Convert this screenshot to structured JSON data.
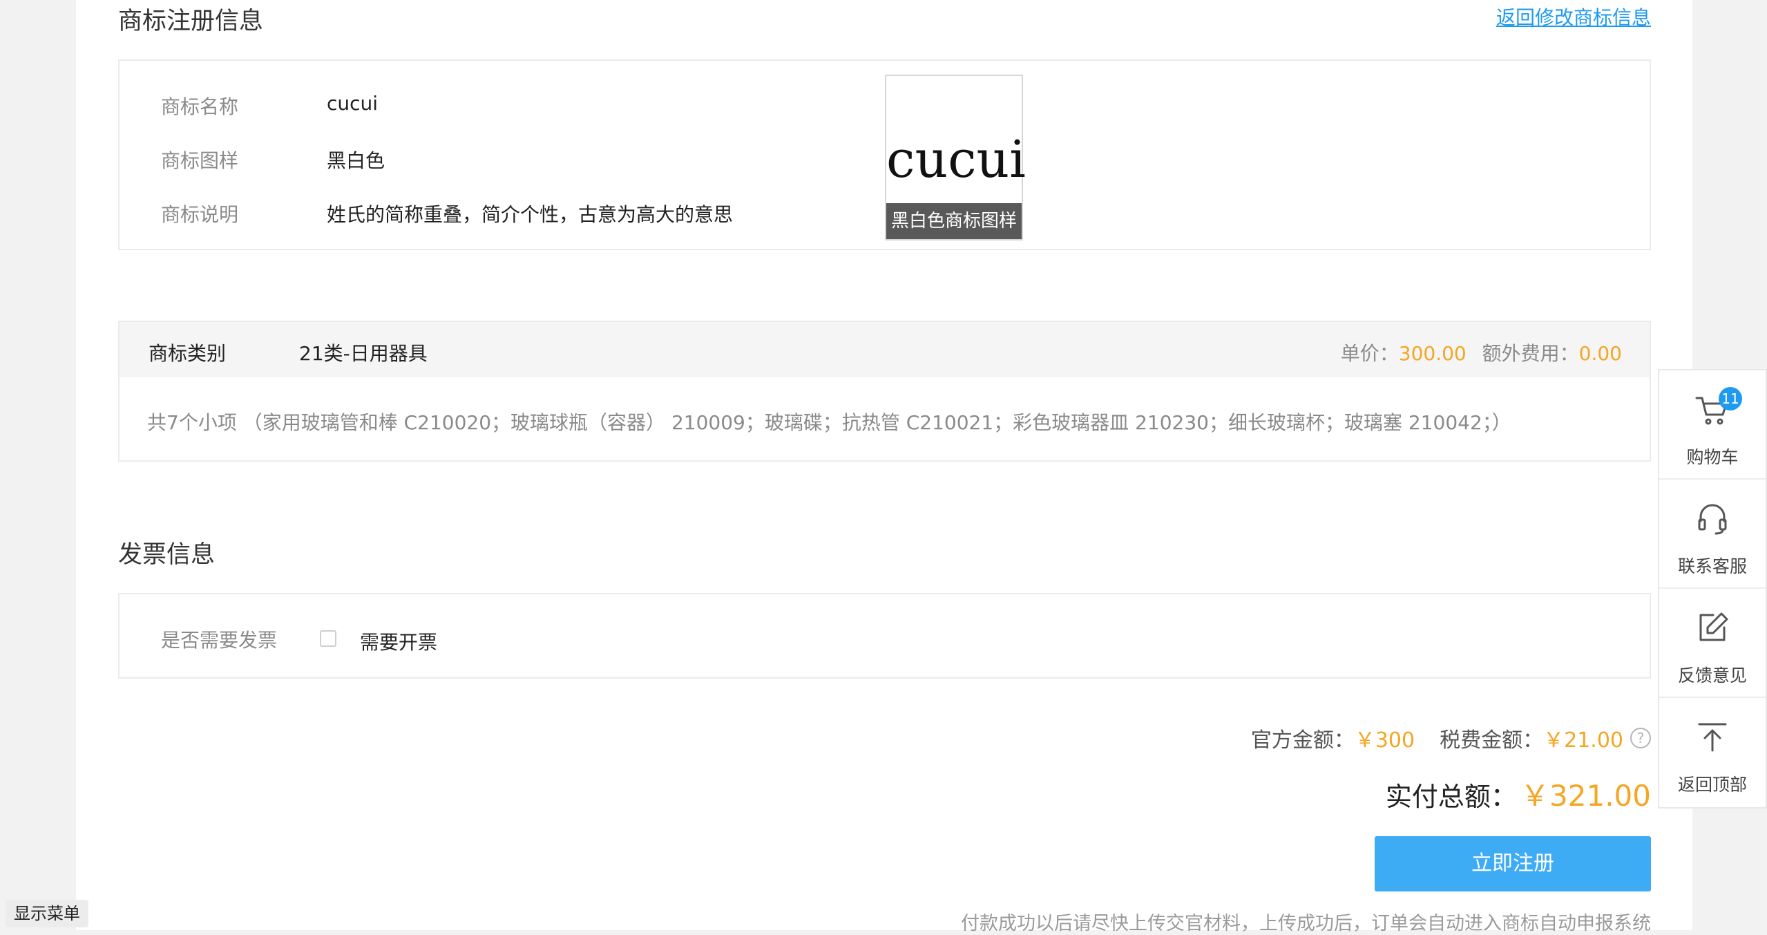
{
  "header": {
    "title": "商标注册信息",
    "back_link": "返回修改商标信息"
  },
  "trademark": {
    "name_label": "商标名称",
    "name_value": "cucui",
    "pattern_label": "商标图样",
    "pattern_value": "黑白色",
    "desc_label": "商标说明",
    "desc_value": "姓氏的简称重叠，简介个性，古意为高大的意思",
    "logo_text": "cucui",
    "logo_caption": "黑白色商标图样"
  },
  "category": {
    "label": "商标类别",
    "value": "21类-日用器具",
    "unit_price_label": "单价：",
    "unit_price": "300.00",
    "extra_fee_label": "额外费用：",
    "extra_fee": "0.00",
    "items_text": "共7个小项 （家用玻璃管和棒 C210020；玻璃球瓶（容器） 210009；玻璃碟；抗热管 C210021；彩色玻璃器皿 210230；细长玻璃杯；玻璃塞 210042；）"
  },
  "invoice": {
    "title": "发票信息",
    "need_label": "是否需要发票",
    "checkbox_label": "需要开票",
    "checked": false
  },
  "summary": {
    "official_label": "官方金额：",
    "official_value": "￥300",
    "tax_label": "税费金额：",
    "tax_value": "￥21.00",
    "tax_help": "?",
    "total_label": "实付总额：",
    "total_value": "￥321.00",
    "submit_label": "立即注册",
    "note": "付款成功以后请尽快上传交官材料，上传成功后，订单会自动进入商标自动申报系统"
  },
  "sidebar": {
    "items": [
      {
        "label": "购物车",
        "icon": "cart-icon",
        "badge": "11"
      },
      {
        "label": "联系客服",
        "icon": "headset-icon"
      },
      {
        "label": "反馈意见",
        "icon": "edit-icon"
      },
      {
        "label": "返回顶部",
        "icon": "arrow-up-icon"
      }
    ]
  },
  "menu_toggle": "显示菜单",
  "colors": {
    "accent_blue": "#3eabf5",
    "link_blue": "#1e9bf0",
    "price_orange": "#f5a623"
  }
}
